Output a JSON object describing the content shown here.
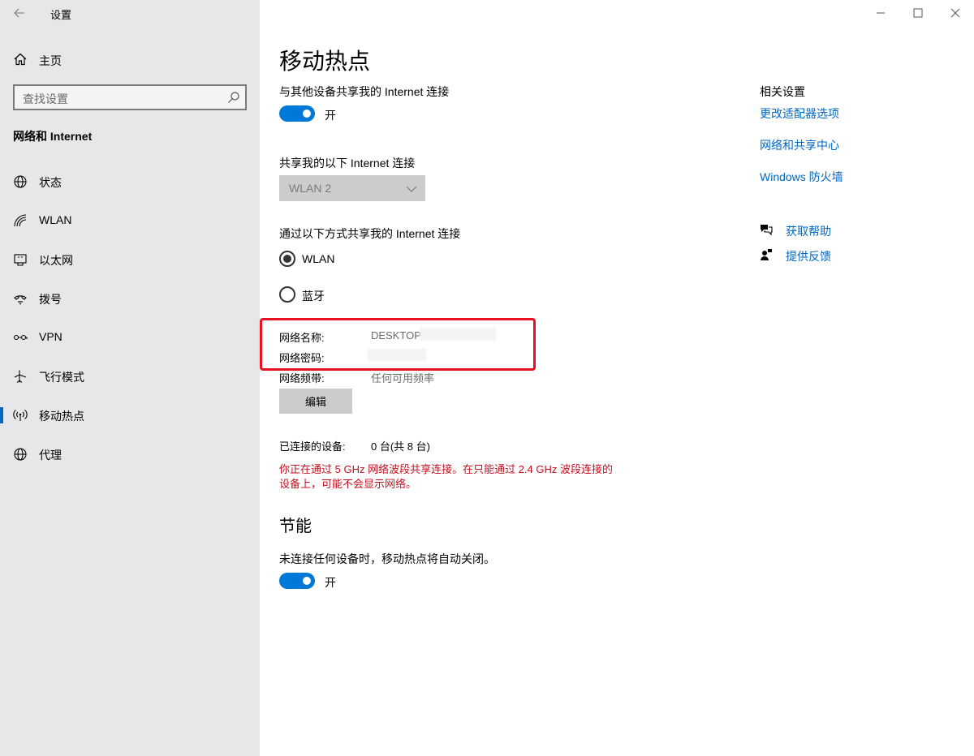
{
  "window": {
    "title": "设置"
  },
  "sidebar": {
    "home_label": "主页",
    "search_placeholder": "查找设置",
    "section_title": "网络和 Internet",
    "items": [
      {
        "label": "状态",
        "icon": "globe-icon"
      },
      {
        "label": "WLAN",
        "icon": "wifi-icon"
      },
      {
        "label": "以太网",
        "icon": "ethernet-icon"
      },
      {
        "label": "拨号",
        "icon": "dialup-icon"
      },
      {
        "label": "VPN",
        "icon": "vpn-icon"
      },
      {
        "label": "飞行模式",
        "icon": "airplane-icon"
      },
      {
        "label": "移动热点",
        "icon": "hotspot-icon",
        "active": true
      },
      {
        "label": "代理",
        "icon": "globe-icon"
      }
    ]
  },
  "main": {
    "title": "移动热点",
    "share_label": "与其他设备共享我的 Internet 连接",
    "share_toggle": {
      "state_label": "开",
      "on": true
    },
    "share_from_label": "共享我的以下 Internet 连接",
    "share_from_value": "WLAN 2",
    "share_via_label": "通过以下方式共享我的 Internet 连接",
    "share_via_options": [
      {
        "label": "WLAN",
        "checked": true
      },
      {
        "label": "蓝牙",
        "checked": false
      }
    ],
    "network_name_key": "网络名称:",
    "network_name_value": "DESKTOP",
    "network_password_key": "网络密码:",
    "network_band_key": "网络频带:",
    "network_band_value": "任何可用频率",
    "edit_button": "编辑",
    "connected_key": "已连接的设备:",
    "connected_value": "0 台(共 8 台)",
    "warning_line1": "你正在通过 5 GHz 网络波段共享连接。在只能通过 2.4 GHz 波段连接的",
    "warning_line2": "设备上，可能不会显示网络。",
    "power_title": "节能",
    "power_desc": "未连接任何设备时，移动热点将自动关闭。",
    "power_toggle": {
      "state_label": "开",
      "on": true
    }
  },
  "related": {
    "title": "相关设置",
    "links": [
      "更改适配器选项",
      "网络和共享中心",
      "Windows 防火墙"
    ],
    "help_label": "获取帮助",
    "feedback_label": "提供反馈"
  },
  "colors": {
    "accent": "#0078d7",
    "link": "#0067c0",
    "warning": "#c50f1f",
    "highlight": "#e81123",
    "sidebar_bg": "#e6e7e8"
  }
}
